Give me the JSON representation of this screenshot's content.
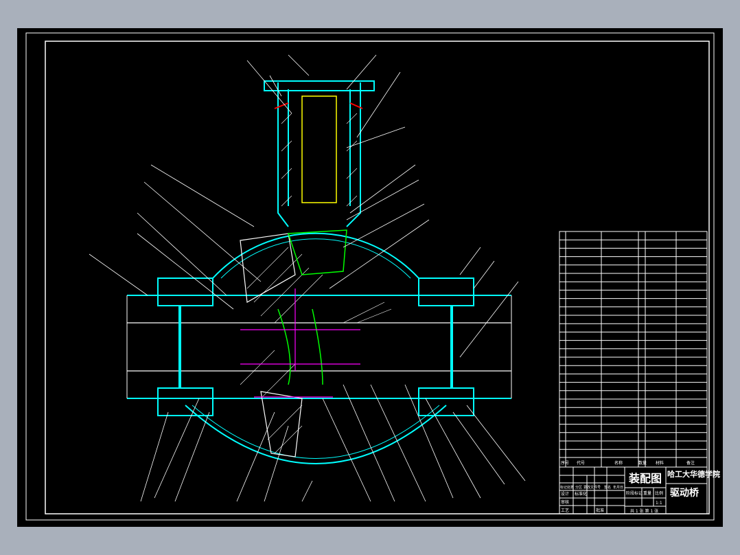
{
  "colors": {
    "background": "#a9b0bb",
    "canvas": "#000000",
    "outline": "#00ffff",
    "frame": "#ffffff",
    "shaft": "#ffff00",
    "gear": "#00ff00",
    "centerline": "#ff00ff",
    "seal": "#ff0000"
  },
  "title_block": {
    "drawing_type": "装配图",
    "school": "哈工大华德学院",
    "part_name": "驱动桥",
    "scale": "1:1",
    "sheets": "共 1 张 第 1 张",
    "header": {
      "no": "序号",
      "code": "代号",
      "name": "名称",
      "qty": "数量",
      "material": "材料",
      "remark": "备注"
    },
    "labels": {
      "mark": "标记",
      "count": "处数",
      "zone": "分区",
      "change": "更改文件号",
      "sign": "签名",
      "date": "年月日",
      "design": "设计",
      "standard": "标准化",
      "review": "审核",
      "process": "工艺",
      "approve": "批准",
      "stage": "阶段标记",
      "weight": "重量",
      "ratio": "比例"
    }
  }
}
